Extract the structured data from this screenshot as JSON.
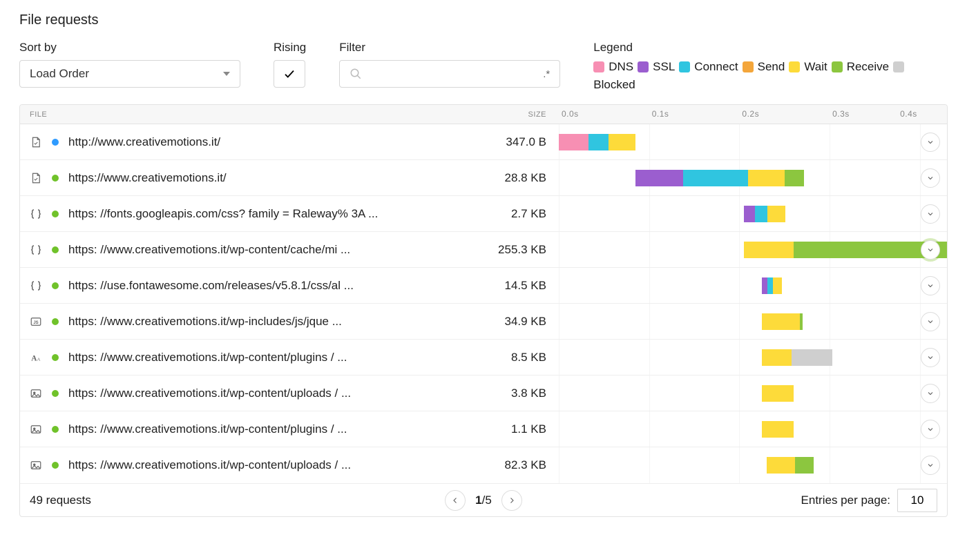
{
  "title": "File requests",
  "controls": {
    "sort_label": "Sort by",
    "sort_value": "Load Order",
    "rising_label": "Rising",
    "filter_label": "Filter",
    "filter_placeholder": "",
    "filter_regex": ".*"
  },
  "legend": {
    "title": "Legend",
    "items": [
      {
        "key": "dns",
        "label": "DNS",
        "color": "#f78fb3"
      },
      {
        "key": "ssl",
        "label": "SSL",
        "color": "#9b5ecf"
      },
      {
        "key": "connect",
        "label": "Connect",
        "color": "#30c5e0"
      },
      {
        "key": "send",
        "label": "Send",
        "color": "#f4a63b"
      },
      {
        "key": "wait",
        "label": "Wait",
        "color": "#fddb3a"
      },
      {
        "key": "receive",
        "label": "Receive",
        "color": "#8cc63f"
      },
      {
        "key": "blocked",
        "label": "Blocked",
        "color": "#cfcfcf"
      }
    ]
  },
  "columns": {
    "file": "FILE",
    "size": "SIZE"
  },
  "timeline": {
    "unit": "s",
    "max": 0.43,
    "ticks": [
      {
        "value": 0.0,
        "label": "0.0s"
      },
      {
        "value": 0.1,
        "label": "0.1s"
      },
      {
        "value": 0.2,
        "label": "0.2s"
      },
      {
        "value": 0.3,
        "label": "0.3s"
      },
      {
        "value": 0.4,
        "label": "0.4s",
        "align": "right"
      }
    ]
  },
  "rows": [
    {
      "icon": "doc",
      "status": "redirect",
      "status_color": "#2f9bff",
      "url": "http://www.creativemotions.it/",
      "size": "347.0 B",
      "start": 0.0,
      "segments": [
        {
          "key": "dns",
          "dur": 0.033
        },
        {
          "key": "connect",
          "dur": 0.022
        },
        {
          "key": "wait",
          "dur": 0.03
        }
      ]
    },
    {
      "icon": "doc",
      "status": "ok",
      "status_color": "#70c22a",
      "url": "https://www.creativemotions.it/",
      "size": "28.8 KB",
      "start": 0.085,
      "segments": [
        {
          "key": "ssl",
          "dur": 0.053
        },
        {
          "key": "connect",
          "dur": 0.072
        },
        {
          "key": "wait",
          "dur": 0.04
        },
        {
          "key": "receive",
          "dur": 0.022
        }
      ]
    },
    {
      "icon": "css",
      "status": "ok",
      "status_color": "#70c22a",
      "url": "https: //fonts.googleapis.com/css? family = Raleway% 3A ...",
      "size": "2.7 KB",
      "start": 0.205,
      "segments": [
        {
          "key": "ssl",
          "dur": 0.012
        },
        {
          "key": "connect",
          "dur": 0.014
        },
        {
          "key": "wait",
          "dur": 0.02
        }
      ]
    },
    {
      "icon": "css",
      "status": "ok",
      "status_color": "#70c22a",
      "url": "https: //www.creativemotions.it/wp-content/cache/mi ...",
      "size": "255.3 KB",
      "start": 0.205,
      "highlight": true,
      "segments": [
        {
          "key": "wait",
          "dur": 0.055
        },
        {
          "key": "receive",
          "dur": 0.17
        }
      ]
    },
    {
      "icon": "css",
      "status": "ok",
      "status_color": "#70c22a",
      "url": "https: //use.fontawesome.com/releases/v5.8.1/css/al ...",
      "size": "14.5 KB",
      "start": 0.225,
      "segments": [
        {
          "key": "ssl",
          "dur": 0.006
        },
        {
          "key": "connect",
          "dur": 0.006
        },
        {
          "key": "wait",
          "dur": 0.01
        }
      ]
    },
    {
      "icon": "js",
      "status": "ok",
      "status_color": "#70c22a",
      "url": "https: //www.creativemotions.it/wp-includes/js/jque ...",
      "size": "34.9 KB",
      "start": 0.225,
      "segments": [
        {
          "key": "wait",
          "dur": 0.042
        },
        {
          "key": "receive",
          "dur": 0.003
        }
      ]
    },
    {
      "icon": "font",
      "status": "ok",
      "status_color": "#70c22a",
      "url": "https: //www.creativemotions.it/wp-content/plugins / ...",
      "size": "8.5 KB",
      "start": 0.225,
      "segments": [
        {
          "key": "wait",
          "dur": 0.033
        },
        {
          "key": "blocked",
          "dur": 0.045
        }
      ]
    },
    {
      "icon": "img",
      "status": "ok",
      "status_color": "#70c22a",
      "url": "https: //www.creativemotions.it/wp-content/uploads / ...",
      "size": "3.8 KB",
      "start": 0.225,
      "segments": [
        {
          "key": "wait",
          "dur": 0.035
        }
      ]
    },
    {
      "icon": "img",
      "status": "ok",
      "status_color": "#70c22a",
      "url": "https: //www.creativemotions.it/wp-content/plugins / ...",
      "size": "1.1 KB",
      "start": 0.225,
      "segments": [
        {
          "key": "wait",
          "dur": 0.035
        }
      ]
    },
    {
      "icon": "img",
      "status": "ok",
      "status_color": "#70c22a",
      "url": "https: //www.creativemotions.it/wp-content/uploads / ...",
      "size": "82.3 KB",
      "start": 0.23,
      "segments": [
        {
          "key": "wait",
          "dur": 0.032
        },
        {
          "key": "receive",
          "dur": 0.02
        }
      ]
    }
  ],
  "footer": {
    "count_text": "49 requests",
    "page_current": "1",
    "page_sep": "/",
    "page_total": "5",
    "entries_label": "Entries per page:",
    "entries_value": "10"
  }
}
